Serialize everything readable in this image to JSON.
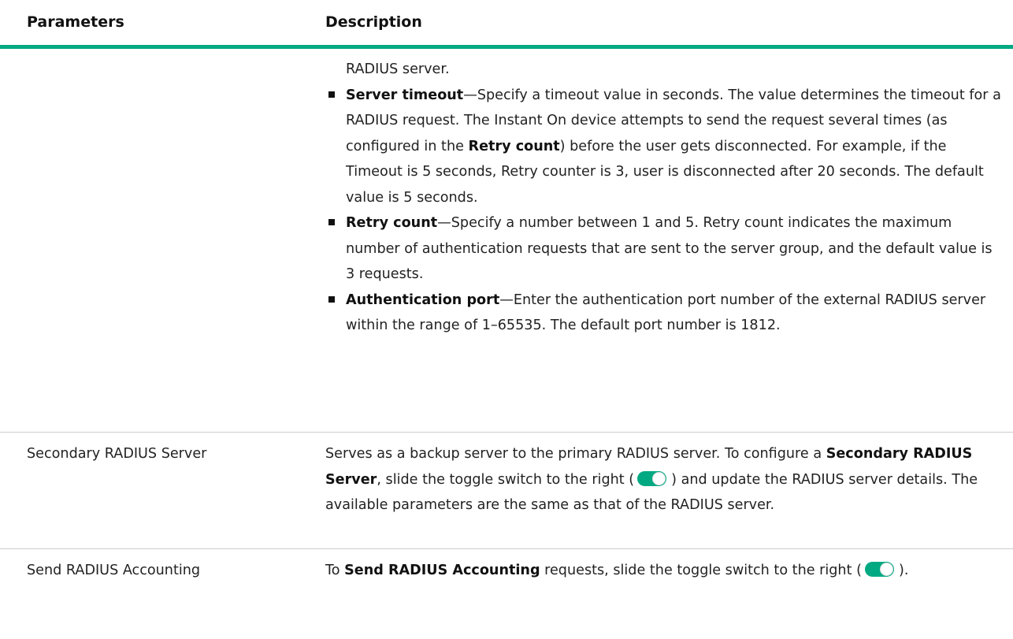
{
  "header": {
    "col_parameters": "Parameters",
    "col_description": "Description"
  },
  "row_radius": {
    "continuation": "RADIUS server.",
    "bullets": [
      {
        "term": "Server timeout",
        "text_1": "—Specify a timeout value in seconds. The value determines the timeout for a RADIUS request. The Instant On device attempts to send the request several times (as configured in the ",
        "bold_2": "Retry count",
        "text_3": ") before the user gets disconnected. For example, if the Timeout is 5 seconds, Retry counter is 3, user is disconnected after 20 seconds. The default value is 5 seconds."
      },
      {
        "term": "Retry count",
        "text_1": "—Specify a number between 1 and 5. Retry count indicates the maximum number of authentication requests that are sent to the server group, and the default value is 3 requests."
      },
      {
        "term": "Authentication port",
        "text_1": "—Enter the authentication port number of the external RADIUS server within the range of 1–65535. The default port number is 1812."
      }
    ]
  },
  "row_secondary": {
    "parameter": "Secondary RADIUS Server",
    "text_1": "Serves as a backup server to the primary RADIUS server. To configure a ",
    "bold": "Secondary RADIUS Server",
    "text_2": ", slide the toggle switch to the right (",
    "text_3": ") and update the RADIUS server details. The available parameters are the same as that of the RADIUS server."
  },
  "row_accounting": {
    "parameter": "Send RADIUS Accounting",
    "text_1": "To ",
    "bold": "Send RADIUS Accounting",
    "text_2": " requests, slide the toggle switch to the right (",
    "text_3": ")."
  },
  "colors": {
    "accent": "#01a982",
    "rule": "#cccccc"
  },
  "icons": {
    "toggle": "toggle-on-icon",
    "bullet": "square-bullet-icon"
  }
}
